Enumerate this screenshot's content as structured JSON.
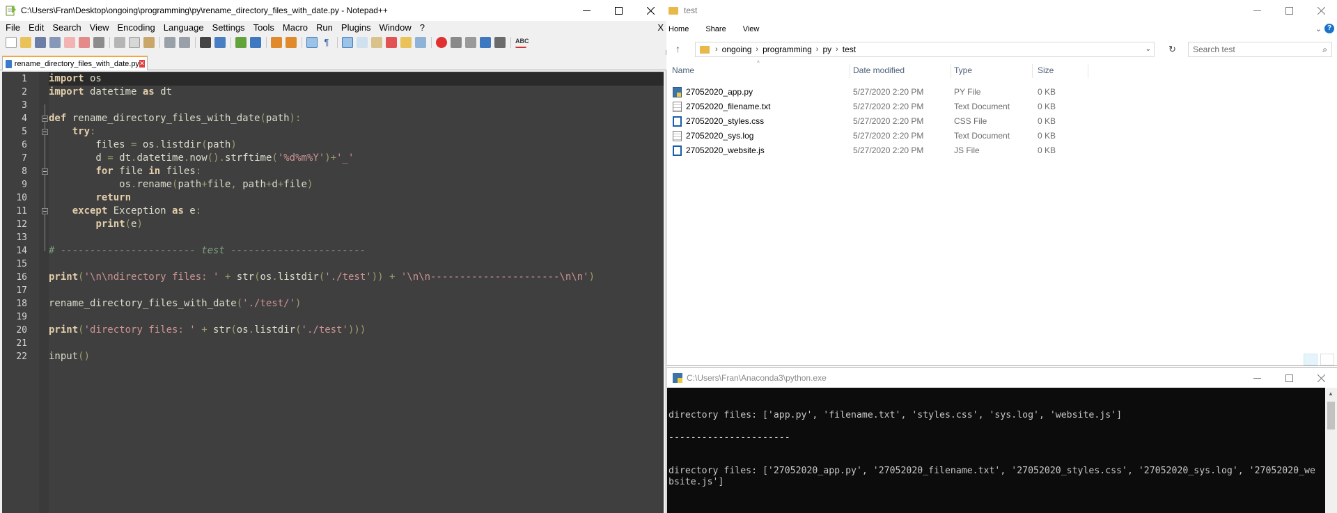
{
  "notepad": {
    "title": "C:\\Users\\Fran\\Desktop\\ongoing\\programming\\py\\rename_directory_files_with_date.py - Notepad++",
    "menu": [
      "File",
      "Edit",
      "Search",
      "View",
      "Encoding",
      "Language",
      "Settings",
      "Tools",
      "Macro",
      "Run",
      "Plugins",
      "Window",
      "?"
    ],
    "menu_close": "X",
    "tab_label": "rename_directory_files_with_date.py",
    "lines": [
      {
        "n": "1",
        "html": "<span class=\"kw\">import</span> os"
      },
      {
        "n": "2",
        "html": "<span class=\"kw\">import</span> datetime <span class=\"kw\">as</span> dt"
      },
      {
        "n": "3",
        "html": ""
      },
      {
        "n": "4",
        "html": "<span class=\"kw\">def</span> rename_directory_files_with_date<span class=\"op\">(</span>path<span class=\"op\">):</span>"
      },
      {
        "n": "5",
        "html": "    <span class=\"kw\">try</span><span class=\"op\">:</span>"
      },
      {
        "n": "6",
        "html": "        files <span class=\"op\">=</span> os<span class=\"op\">.</span>listdir<span class=\"op\">(</span>path<span class=\"op\">)</span>"
      },
      {
        "n": "7",
        "html": "        d <span class=\"op\">=</span> dt<span class=\"op\">.</span>datetime<span class=\"op\">.</span>now<span class=\"op\">().</span>strftime<span class=\"op\">(</span><span class=\"str\">'%d%m%Y'</span><span class=\"op\">)+</span><span class=\"str\">'_'</span>"
      },
      {
        "n": "8",
        "html": "        <span class=\"kw\">for</span> file <span class=\"kw\">in</span> files<span class=\"op\">:</span>"
      },
      {
        "n": "9",
        "html": "            os<span class=\"op\">.</span>rename<span class=\"op\">(</span>path<span class=\"op\">+</span>file<span class=\"op\">,</span> path<span class=\"op\">+</span>d<span class=\"op\">+</span>file<span class=\"op\">)</span>"
      },
      {
        "n": "10",
        "html": "        <span class=\"kw\">return</span>"
      },
      {
        "n": "11",
        "html": "    <span class=\"kw\">except</span> Exception <span class=\"kw\">as</span> e<span class=\"op\">:</span>"
      },
      {
        "n": "12",
        "html": "        <span class=\"kw\">print</span><span class=\"op\">(</span>e<span class=\"op\">)</span>"
      },
      {
        "n": "13",
        "html": ""
      },
      {
        "n": "14",
        "html": "<span class=\"cm\"># ----------------------- test -----------------------</span>"
      },
      {
        "n": "15",
        "html": ""
      },
      {
        "n": "16",
        "html": "<span class=\"kw\">print</span><span class=\"op\">(</span><span class=\"str\">'\\n\\ndirectory files: '</span> <span class=\"op\">+</span> str<span class=\"op\">(</span>os<span class=\"op\">.</span>listdir<span class=\"op\">(</span><span class=\"str\">'./test'</span><span class=\"op\">))</span> <span class=\"op\">+</span> <span class=\"str\">'\\n\\n----------------------\\n\\n'</span><span class=\"op\">)</span>"
      },
      {
        "n": "17",
        "html": ""
      },
      {
        "n": "18",
        "html": "rename_directory_files_with_date<span class=\"op\">(</span><span class=\"str\">'./test/'</span><span class=\"op\">)</span>"
      },
      {
        "n": "19",
        "html": ""
      },
      {
        "n": "20",
        "html": "<span class=\"kw\">print</span><span class=\"op\">(</span><span class=\"str\">'directory files: '</span> <span class=\"op\">+</span> str<span class=\"op\">(</span>os<span class=\"op\">.</span>listdir<span class=\"op\">(</span><span class=\"str\">'./test'</span><span class=\"op\">)))</span>"
      },
      {
        "n": "21",
        "html": ""
      },
      {
        "n": "22",
        "html": "input<span class=\"op\">()</span>"
      }
    ]
  },
  "explorer": {
    "title": "test",
    "ribbon": [
      "Home",
      "Share",
      "View"
    ],
    "breadcrumb": [
      "ongoing",
      "programming",
      "py",
      "test"
    ],
    "search_placeholder": "Search test",
    "columns": [
      "Name",
      "Date modified",
      "Type",
      "Size"
    ],
    "files": [
      {
        "name": "27052020_app.py",
        "date": "5/27/2020 2:20 PM",
        "type": "PY File",
        "size": "0 KB",
        "icon": "py"
      },
      {
        "name": "27052020_filename.txt",
        "date": "5/27/2020 2:20 PM",
        "type": "Text Document",
        "size": "0 KB",
        "icon": "txt"
      },
      {
        "name": "27052020_styles.css",
        "date": "5/27/2020 2:20 PM",
        "type": "CSS File",
        "size": "0 KB",
        "icon": "code"
      },
      {
        "name": "27052020_sys.log",
        "date": "5/27/2020 2:20 PM",
        "type": "Text Document",
        "size": "0 KB",
        "icon": "txt"
      },
      {
        "name": "27052020_website.js",
        "date": "5/27/2020 2:20 PM",
        "type": "JS File",
        "size": "0 KB",
        "icon": "code"
      }
    ]
  },
  "console": {
    "title": "C:\\Users\\Fran\\Anaconda3\\python.exe",
    "output": "\n\ndirectory files: ['app.py', 'filename.txt', 'styles.css', 'sys.log', 'website.js']\n\n----------------------\n\n\ndirectory files: ['27052020_app.py', '27052020_filename.txt', '27052020_styles.css', '27052020_sys.log', '27052020_we\nbsite.js']"
  }
}
